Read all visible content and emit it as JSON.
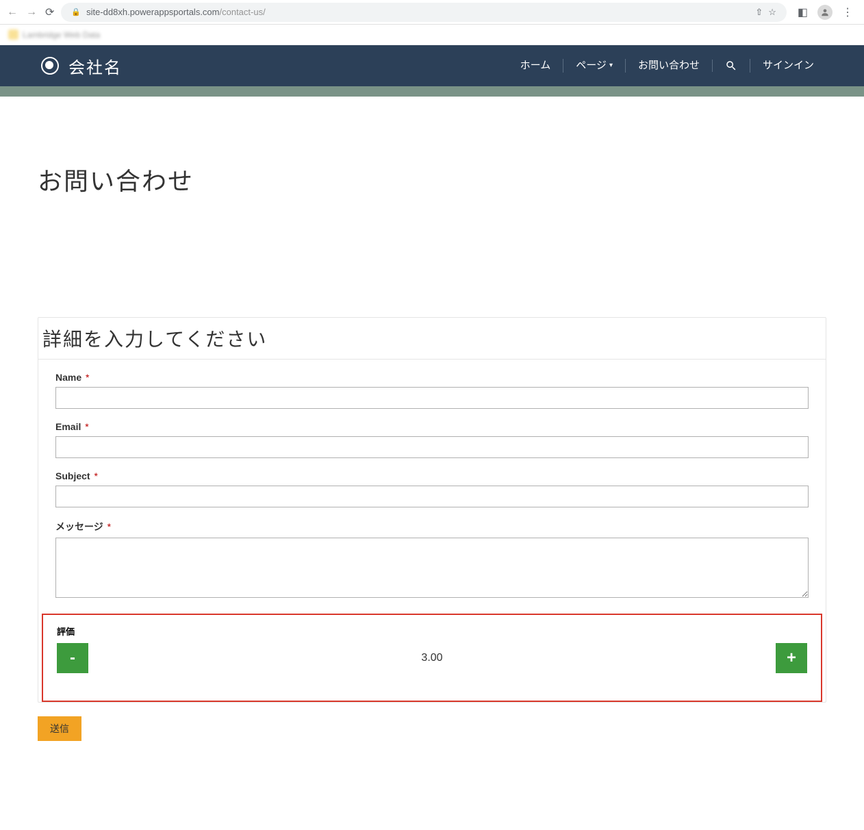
{
  "browser": {
    "url_host": "site-dd8xh.powerappsportals.com",
    "url_path": "/contact-us/",
    "bookmark_label": "Lambridge Web Data"
  },
  "header": {
    "brand": "会社名",
    "nav": {
      "home": "ホーム",
      "pages": "ページ",
      "contact": "お問い合わせ",
      "signin": "サインイン"
    }
  },
  "page": {
    "title": "お問い合わせ",
    "form_title": "詳細を入力してください",
    "fields": {
      "name": {
        "label": "Name"
      },
      "email": {
        "label": "Email"
      },
      "subject": {
        "label": "Subject"
      },
      "message": {
        "label": "メッセージ"
      }
    },
    "rating": {
      "label": "評価",
      "value": "3.00",
      "minus": "-",
      "plus": "+"
    },
    "submit": "送信"
  },
  "colors": {
    "header_bg": "#2c4058",
    "accent_green": "#3d9b3d",
    "highlight_border": "#d9372b",
    "submit_bg": "#f2a324"
  }
}
